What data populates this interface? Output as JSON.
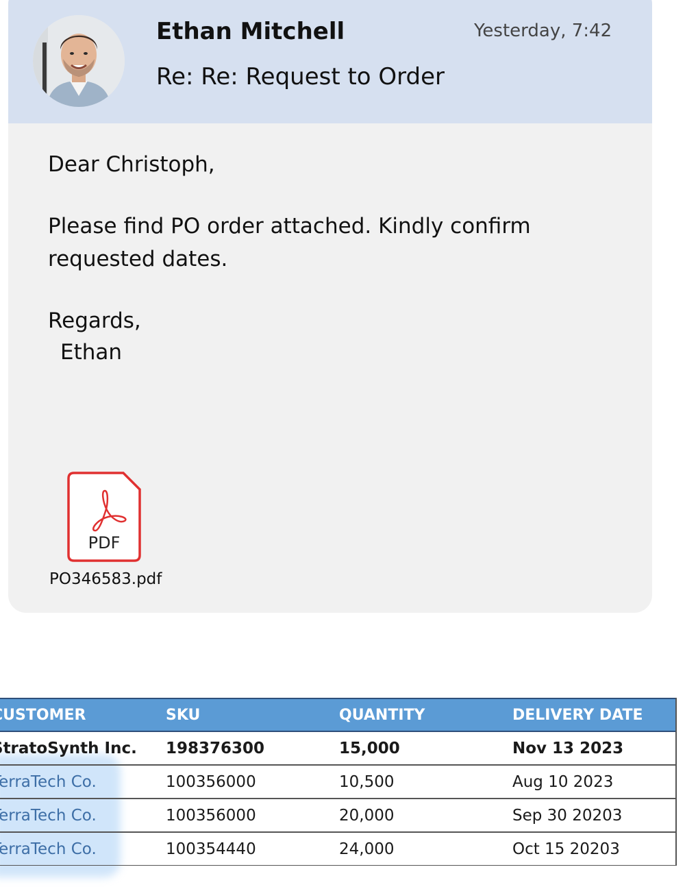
{
  "email": {
    "sender_name": "Ethan Mitchell",
    "subject": "Re: Re: Request to Order",
    "timestamp": "Yesterday, 7:42",
    "body_lines": [
      "Dear Christoph,",
      "Please find PO order attached. Kindly confirm",
      "requested dates.",
      "Regards,",
      "Ethan"
    ],
    "attachment": {
      "icon_label": "PDF",
      "file_name": "PO346583.pdf",
      "icon": "pdf-file-icon"
    }
  },
  "orders_table": {
    "headers": [
      "CUSTOMER",
      "SKU",
      "QUANTITY",
      "DELIVERY DATE"
    ],
    "rows": [
      [
        "StratoSynth Inc.",
        "198376300",
        "15,000",
        "Nov 13 2023"
      ],
      [
        "TerraTech Co.",
        "100356000",
        "10,500",
        "Aug 10 2023"
      ],
      [
        "TerraTech Co.",
        "100356000",
        "20,000",
        "Sep 30 20203"
      ],
      [
        "TerraTech Co.",
        "100354440",
        "24,000",
        "Oct 15 20203"
      ]
    ],
    "header_color": "#5b9bd5"
  },
  "colors": {
    "header_bg": "#d6e0f0",
    "card_bg": "#f1f1f1",
    "pdf_red": "#e03030"
  }
}
